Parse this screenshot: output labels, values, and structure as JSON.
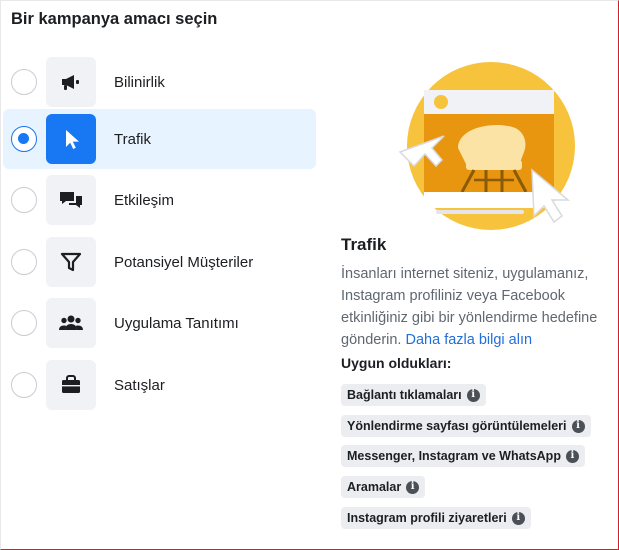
{
  "page": {
    "title": "Bir kampanya amacı seçin"
  },
  "objectives": [
    {
      "label": "Bilinirlik",
      "icon": "megaphone-icon",
      "selected": false
    },
    {
      "label": "Trafik",
      "icon": "cursor-icon",
      "selected": true
    },
    {
      "label": "Etkileşim",
      "icon": "chat-bubbles-icon",
      "selected": false
    },
    {
      "label": "Potansiyel Müşteriler",
      "icon": "funnel-icon",
      "selected": false
    },
    {
      "label": "Uygulama Tanıtımı",
      "icon": "people-icon",
      "selected": false
    },
    {
      "label": "Satışlar",
      "icon": "shopping-bag-icon",
      "selected": false
    }
  ],
  "detail": {
    "title": "Trafik",
    "description": "İnsanları internet siteniz, uygulamanız, Instagram profiliniz veya Facebook etkinliğiniz gibi bir yönlendirme hedefine gönderin.",
    "learn_more": "Daha fazla bilgi alın",
    "suitable_heading": "Uygun oldukları:",
    "chips": [
      "Bağlantı tıklamaları",
      "Yönlendirme sayfası görüntülemeleri",
      "Messenger, Instagram ve WhatsApp",
      "Aramalar",
      "Instagram profili ziyaretleri"
    ]
  },
  "colors": {
    "accent": "#1877f2",
    "selected_bg": "#e7f3ff",
    "icon_bg": "#f0f2f5",
    "illustration_yellow": "#f7c33c",
    "illustration_orange": "#e8950f"
  }
}
